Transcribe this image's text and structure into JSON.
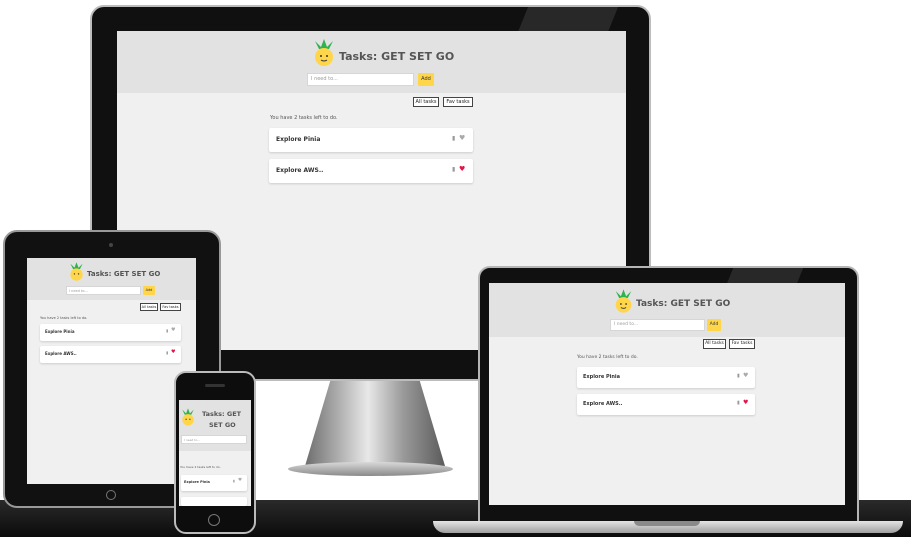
{
  "app": {
    "title": "Tasks: GET SET GO",
    "title_line1": "Tasks: GET",
    "title_line2": "SET GO",
    "input_placeholder": "I need to...",
    "add_label": "Add",
    "filters": [
      "All tasks",
      "Fav tasks"
    ],
    "meta": "You have 2 tasks left to do.",
    "tasks": [
      {
        "name": "Explore Pinia",
        "favorite": false
      },
      {
        "name": "Explore AWS..",
        "favorite": true
      }
    ],
    "logo_icon": "pineapple-icon",
    "delete_icon": "trash-icon",
    "favorite_icon": "heart-icon"
  },
  "colors": {
    "accent": "#ffd54a",
    "header_bg": "#e2e2e2",
    "screen_bg": "#f0f0f0",
    "fav_on": "#e0154a",
    "fav_off": "#aaaaaa"
  }
}
